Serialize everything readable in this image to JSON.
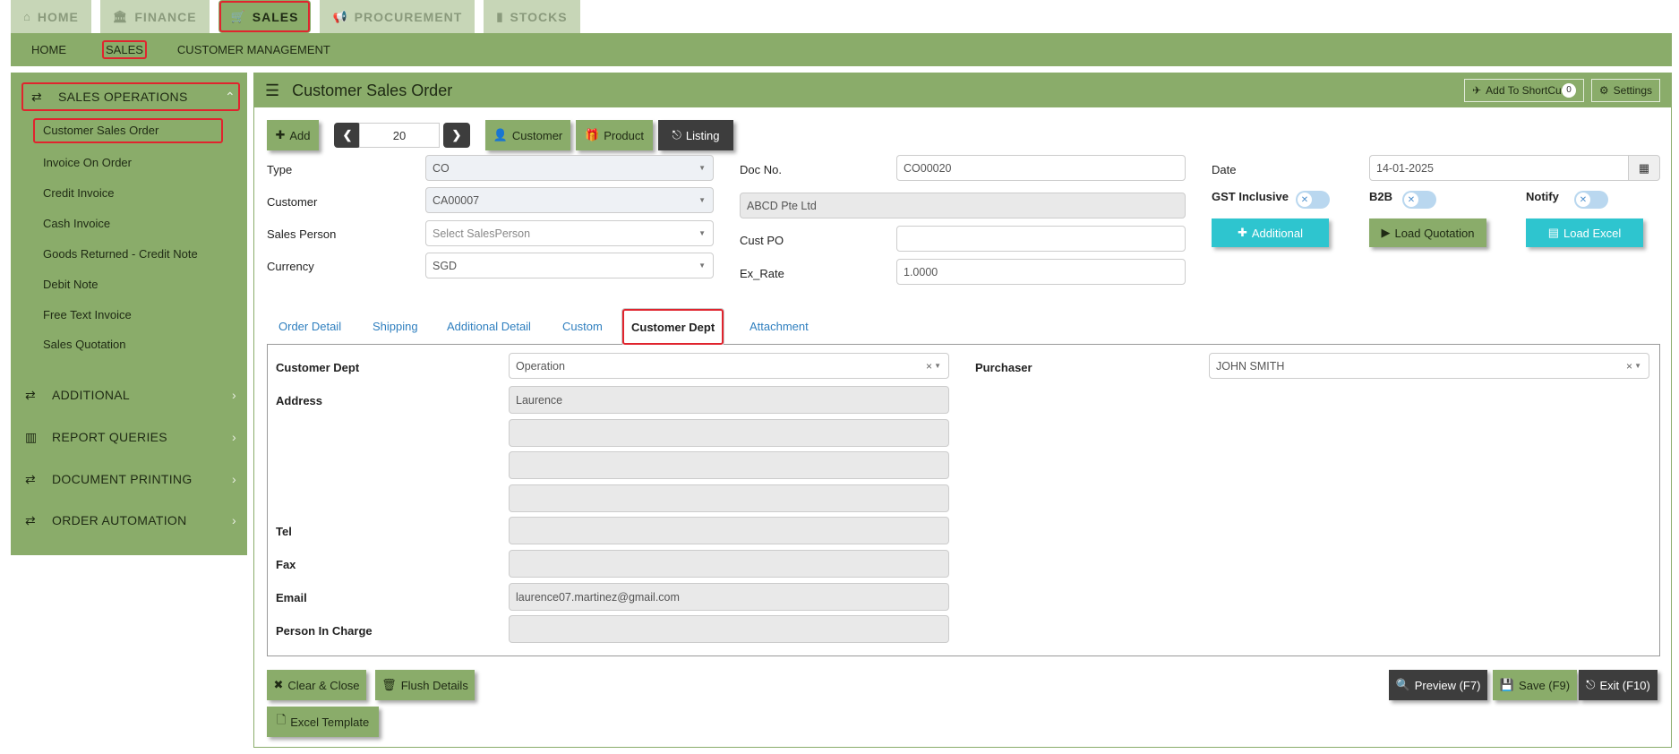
{
  "top_tabs": [
    {
      "label": "HOME",
      "icon": "home-icon",
      "glyph": "⌂"
    },
    {
      "label": "FINANCE",
      "icon": "bank-icon",
      "glyph": "🏛"
    },
    {
      "label": "SALES",
      "icon": "cart-icon",
      "glyph": "🛒"
    },
    {
      "label": "PROCUREMENT",
      "icon": "bullhorn-icon",
      "glyph": "📢"
    },
    {
      "label": "STOCKS",
      "icon": "bar-chart-icon",
      "glyph": "📊"
    }
  ],
  "subnav": [
    "HOME",
    "SALES",
    "CUSTOMER MANAGEMENT"
  ],
  "sidebar": {
    "sections": [
      {
        "label": "SALES OPERATIONS",
        "icon": "exchange-icon"
      },
      {
        "label": "ADDITIONAL",
        "icon": "exchange-icon"
      },
      {
        "label": "REPORT QUERIES",
        "icon": "bar-chart-icon"
      },
      {
        "label": "DOCUMENT PRINTING",
        "icon": "exchange-icon"
      },
      {
        "label": "ORDER AUTOMATION",
        "icon": "exchange-icon"
      }
    ],
    "items": [
      "Customer Sales Order",
      "Invoice On Order",
      "Credit Invoice",
      "Cash Invoice",
      "Goods Returned - Credit Note",
      "Debit Note",
      "Free Text Invoice",
      "Sales Quotation"
    ]
  },
  "header": {
    "title": "Customer Sales Order",
    "shortcut_label": "Add To ShortCut",
    "shortcut_count": "0",
    "settings_label": "Settings"
  },
  "toolbar": {
    "add": "Add",
    "page": "20",
    "customer": "Customer",
    "product": "Product",
    "listing": "Listing"
  },
  "form": {
    "type_label": "Type",
    "type_value": "CO",
    "customer_label": "Customer",
    "customer_value": "CA00007",
    "sales_person_label": "Sales Person",
    "sales_person_placeholder": "Select SalesPerson",
    "currency_label": "Currency",
    "currency_value": "SGD",
    "doc_no_label": "Doc No.",
    "doc_no_value": "CO00020",
    "customer_name_value": "ABCD Pte Ltd",
    "cust_po_label": "Cust PO",
    "cust_po_value": "",
    "ex_rate_label": "Ex_Rate",
    "ex_rate_value": "1.0000",
    "date_label": "Date",
    "date_value": "14-01-2025",
    "gst_label": "GST Inclusive",
    "gst_on": false,
    "b2b_label": "B2B",
    "b2b_on": false,
    "notify_label": "Notify",
    "notify_on": false,
    "additional_btn": "Additional",
    "load_quotation_btn": "Load Quotation",
    "load_excel_btn": "Load Excel"
  },
  "detail_tabs": [
    "Order Detail",
    "Shipping",
    "Additional Detail",
    "Custom",
    "Customer Dept",
    "Attachment"
  ],
  "customer_dept": {
    "dept_label": "Customer Dept",
    "dept_value": "Operation",
    "purchaser_label": "Purchaser",
    "purchaser_value": "JOHN SMITH",
    "address_label": "Address",
    "address_lines": [
      "Laurence",
      "",
      "",
      ""
    ],
    "tel_label": "Tel",
    "tel_value": "",
    "fax_label": "Fax",
    "fax_value": "",
    "email_label": "Email",
    "email_value": "laurence07.martinez@gmail.com",
    "pic_label": "Person In Charge",
    "pic_value": ""
  },
  "footer": {
    "clear_close": "Clear & Close",
    "flush_details": "Flush Details",
    "excel_template": "Excel Template",
    "preview": "Preview (F7)",
    "save": "Save (F9)",
    "exit": "Exit (F10)"
  }
}
